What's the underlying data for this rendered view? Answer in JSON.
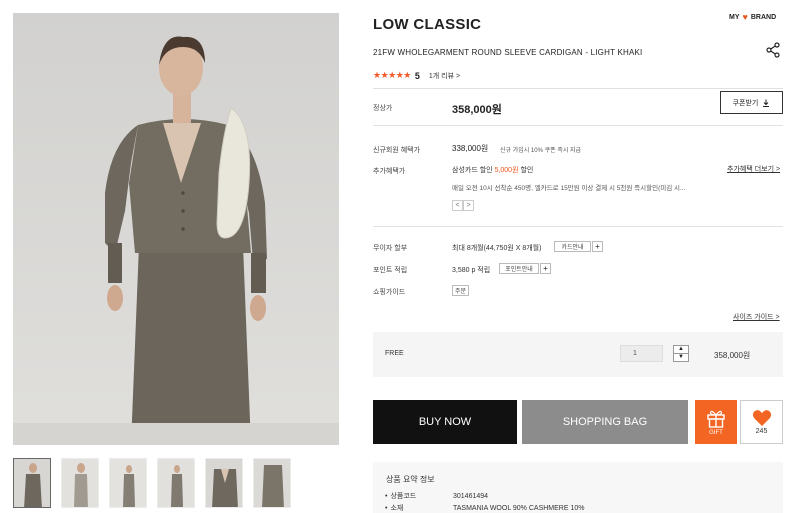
{
  "gallery": {
    "main_image_alt": "model wearing cardigan and skirt",
    "thumbnail_count": 6
  },
  "header": {
    "brand": "LOW CLASSIC",
    "my_label": "MY",
    "brand_label": "BRAND",
    "heart_icon": "heart-icon"
  },
  "product": {
    "name": "21FW WHOLEGARMENT ROUND SLEEVE CARDIGAN - LIGHT KHAKI",
    "rating_stars": "★★★★★",
    "rating_score": "5",
    "review_link": "1개 리뷰 >"
  },
  "price": {
    "label": "정상가",
    "value": "358,000원",
    "coupon_button": "쿠폰받기",
    "coupon_icon": "download-icon"
  },
  "benefits": {
    "member_label": "신규회원 혜택가",
    "member_price": "338,000원",
    "member_note": "신규 가입시 10% 쿠폰 즉시 지급",
    "extra_label": "추가혜택가",
    "card_prefix": "삼성카드",
    "card_discount_label": "할인",
    "card_amount": "5,000원",
    "card_suffix": "할인",
    "extra_more": "추가혜택 더보기 >",
    "extra_desc": "매일 오전 10시 선착순 450명, 엘카드로 15만원 이상 결제 시 5천원 즉시할인(미김 시...",
    "prev": "<",
    "next": ">"
  },
  "purchase_info": {
    "installment_label": "무이자 할부",
    "installment_value": "최대 8개월(44,750원 X 8개월)",
    "installment_btn": "카드안내",
    "points_label": "포인트 적립",
    "points_value": "3,580 p 적립",
    "points_btn": "포인트안내",
    "guide_label": "쇼핑가이드",
    "guide_btn": "주문",
    "plus": "+"
  },
  "size_guide": "사이즈 가이드 >",
  "option": {
    "name": "FREE",
    "quantity": "1",
    "up": "▲",
    "down": "▼",
    "price": "358,000원"
  },
  "actions": {
    "buy_now": "BUY NOW",
    "shopping_bag": "SHOPPING BAG",
    "gift_label": "GIFT",
    "like_count": "245"
  },
  "summary": {
    "title": "상품 요약 정보",
    "rows": [
      {
        "key": "상품코드",
        "value": "301461494"
      },
      {
        "key": "소재",
        "value": "TASMANIA WOOL 90% CASHMERE 10%"
      }
    ]
  },
  "colors": {
    "accent": "#f26522",
    "buy_bg": "#111111",
    "bag_bg": "#8c8c8c"
  }
}
